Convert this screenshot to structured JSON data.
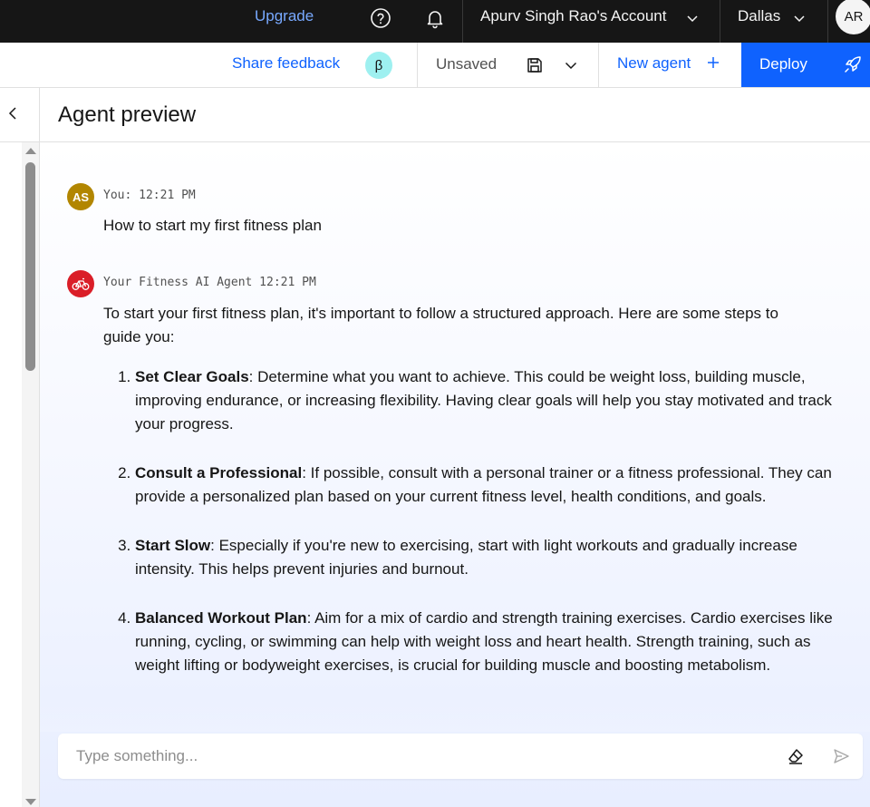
{
  "topbar": {
    "upgrade_label": "Upgrade",
    "account_label": "Apurv Singh Rao's Account",
    "region_label": "Dallas",
    "avatar_initials": "AR"
  },
  "toolbar": {
    "share_feedback_label": "Share feedback",
    "beta_badge": "β",
    "unsaved_label": "Unsaved",
    "new_agent_label": "New agent",
    "deploy_label": "Deploy"
  },
  "header": {
    "title": "Agent preview"
  },
  "chat": {
    "user": {
      "initials": "AS",
      "meta": "You: 12:21 PM",
      "text": "How to start my first fitness plan"
    },
    "agent": {
      "meta": "Your Fitness AI Agent 12:21 PM",
      "intro": "To start your first fitness plan, it's important to follow a structured approach. Here are some steps to guide you:",
      "steps": [
        {
          "title": "Set Clear Goals",
          "text": ": Determine what you want to achieve. This could be weight loss, building muscle, improving endurance, or increasing flexibility. Having clear goals will help you stay motivated and track your progress."
        },
        {
          "title": "Consult a Professional",
          "text": ": If possible, consult with a personal trainer or a fitness professional. They can provide a personalized plan based on your current fitness level, health conditions, and goals."
        },
        {
          "title": "Start Slow",
          "text": ": Especially if you're new to exercising, start with light workouts and gradually increase intensity. This helps prevent injuries and burnout."
        },
        {
          "title": "Balanced Workout Plan",
          "text": ": Aim for a mix of cardio and strength training exercises. Cardio exercises like running, cycling, or swimming can help with weight loss and heart health. Strength training, such as weight lifting or bodyweight exercises, is crucial for building muscle and boosting metabolism."
        }
      ]
    }
  },
  "composer": {
    "placeholder": "Type something..."
  },
  "colors": {
    "brand_blue": "#0f62fe",
    "topbar_bg": "#161616",
    "user_avatar": "#b28600",
    "agent_avatar": "#da1e28",
    "beta_badge_bg": "#9ef0f0"
  },
  "icons": {
    "help": "help-icon",
    "notification": "bell-icon",
    "save": "save-icon",
    "add": "plus-icon",
    "deploy": "rocket-icon",
    "back": "chevron-left-icon",
    "agent_avatar": "bicycle-icon",
    "clear": "eraser-icon",
    "send": "send-icon"
  }
}
